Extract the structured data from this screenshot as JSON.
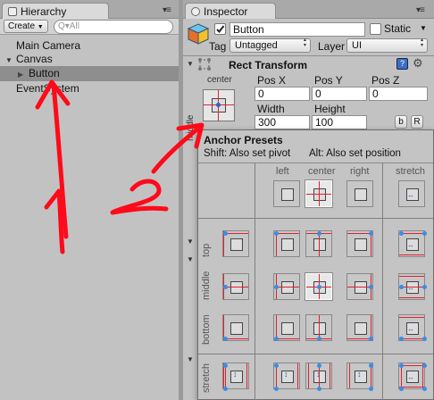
{
  "hierarchy": {
    "tab_title": "Hierarchy",
    "create_label": "Create",
    "search_placeholder": "Q▾All",
    "items": [
      {
        "label": "Main Camera",
        "indent": 0
      },
      {
        "label": "Canvas",
        "indent": 0,
        "expanded": true
      },
      {
        "label": "Button",
        "indent": 1,
        "selected": true
      },
      {
        "label": "EventSystem",
        "indent": 0
      }
    ]
  },
  "inspector": {
    "tab_title": "Inspector",
    "object_name": "Button",
    "active_checked": true,
    "static_label": "Static",
    "tag_label": "Tag",
    "tag_value": "Untagged",
    "layer_label": "Layer",
    "layer_value": "UI",
    "component_title": "Rect Transform",
    "anchor_h_label": "center",
    "anchor_v_label": "middle",
    "pos_labels": [
      "Pos X",
      "Pos Y",
      "Pos Z"
    ],
    "pos_values": [
      "0",
      "0",
      "0"
    ],
    "size_labels": [
      "Width",
      "Height"
    ],
    "size_values": [
      "300",
      "100"
    ],
    "blueprint_btn": "b",
    "raw_btn": "R"
  },
  "anchor_presets": {
    "title": "Anchor Presets",
    "hint_shift": "Shift: Also set pivot",
    "hint_alt": "Alt: Also set position",
    "columns": [
      "left",
      "center",
      "right",
      "stretch"
    ],
    "rows": [
      "top",
      "middle",
      "bottom",
      "stretch"
    ]
  },
  "annotations": {
    "color": "#ff0a1a",
    "label_1": "1",
    "label_2": "2"
  },
  "colors": {
    "panel_bg": "#c2c2c2",
    "selected_row": "#8e8e8e",
    "anchor_dot": "#3a8de8",
    "pivot_red": "#dd2233"
  }
}
